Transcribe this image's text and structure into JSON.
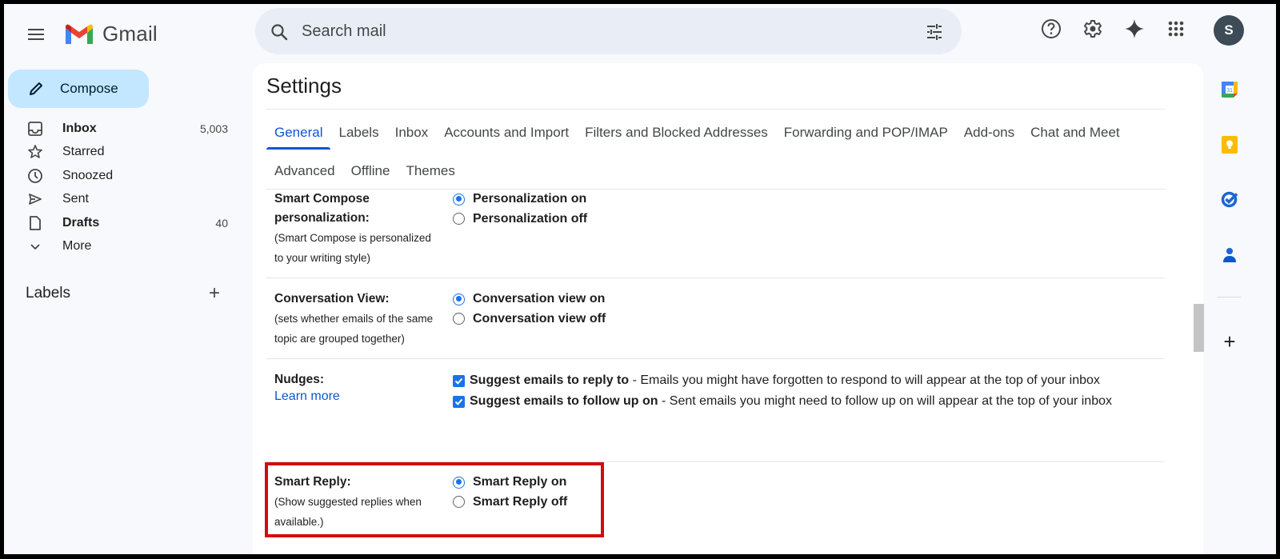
{
  "app": {
    "name": "Gmail"
  },
  "header": {
    "search_placeholder": "Search mail",
    "avatar_initial": "S",
    "icons": [
      "menu-icon",
      "search-icon",
      "search-options-icon",
      "help-icon",
      "settings-gear-icon",
      "gemini-sparkle-icon",
      "apps-grid-icon"
    ]
  },
  "sidebar": {
    "compose_label": "Compose",
    "items": [
      {
        "label": "Inbox",
        "count": "5,003",
        "bold": true,
        "icon": "inbox-icon"
      },
      {
        "label": "Starred",
        "count": "",
        "bold": false,
        "icon": "star-icon"
      },
      {
        "label": "Snoozed",
        "count": "",
        "bold": false,
        "icon": "clock-icon"
      },
      {
        "label": "Sent",
        "count": "",
        "bold": false,
        "icon": "send-icon"
      },
      {
        "label": "Drafts",
        "count": "40",
        "bold": true,
        "icon": "draft-icon"
      },
      {
        "label": "More",
        "count": "",
        "bold": false,
        "icon": "chevron-down-icon"
      }
    ],
    "labels_heading": "Labels",
    "labels_add": "+"
  },
  "settings": {
    "title": "Settings",
    "tabs_row1": [
      "General",
      "Labels",
      "Inbox",
      "Accounts and Import",
      "Filters and Blocked Addresses",
      "Forwarding and POP/IMAP",
      "Add-ons",
      "Chat and Meet"
    ],
    "tabs_row2": [
      "Advanced",
      "Offline",
      "Themes"
    ],
    "active_tab": "General",
    "sections": {
      "smart_compose": {
        "title_line1": "Smart Compose",
        "title_line2": "personalization:",
        "desc_line1": "(Smart Compose is personalized",
        "desc_line2": "to your writing style)",
        "options": [
          {
            "label": "Personalization on",
            "selected": true
          },
          {
            "label": "Personalization off",
            "selected": false
          }
        ]
      },
      "conversation_view": {
        "title": "Conversation View:",
        "desc_line1": "(sets whether emails of the same",
        "desc_line2": "topic are grouped together)",
        "options": [
          {
            "label": "Conversation view on",
            "selected": true
          },
          {
            "label": "Conversation view off",
            "selected": false
          }
        ]
      },
      "nudges": {
        "title": "Nudges:",
        "link": "Learn more",
        "options": [
          {
            "bold": "Suggest emails to reply to",
            "text": " - Emails you might have forgotten to respond to will appear at the top of your inbox",
            "checked": true
          },
          {
            "bold": "Suggest emails to follow up on",
            "text": " - Sent emails you might need to follow up on will appear at the top of your inbox",
            "checked": true
          }
        ]
      },
      "smart_reply": {
        "title": "Smart Reply:",
        "desc_line1": "(Show suggested replies when",
        "desc_line2": "available.)",
        "options": [
          {
            "label": "Smart Reply on",
            "selected": true
          },
          {
            "label": "Smart Reply off",
            "selected": false
          }
        ],
        "highlighted": true
      }
    }
  },
  "right_rail": {
    "apps": [
      "calendar-icon",
      "keep-icon",
      "tasks-icon",
      "contacts-icon"
    ],
    "add_label": "+"
  },
  "colors": {
    "accent": "#0b57d0",
    "compose_bg": "#c2e7ff",
    "highlight_border": "#d40c0c",
    "avatar_bg": "#3c4b55"
  }
}
